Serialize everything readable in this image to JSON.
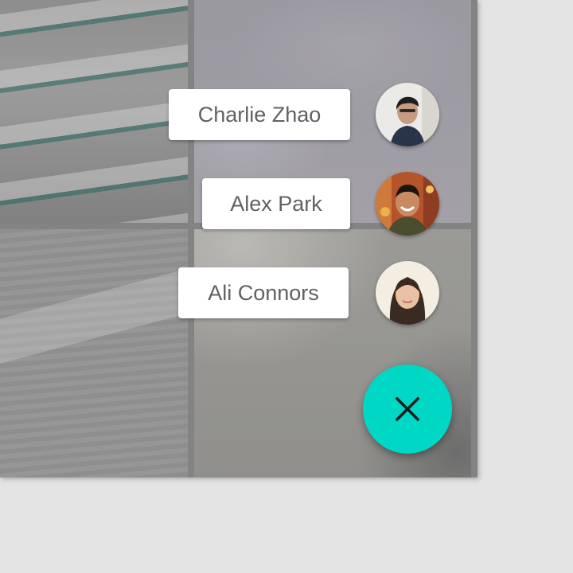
{
  "speed_dial": {
    "contacts": [
      {
        "name": "Charlie Zhao"
      },
      {
        "name": "Alex Park"
      },
      {
        "name": "Ali Connors"
      }
    ],
    "fab_icon": "close-icon",
    "fab_color": "#00d7c5"
  },
  "background_tiles": [
    "snow-landscape-photo",
    "misty-rocks-photo",
    "sand-dunes-photo",
    "stone-hill-photo"
  ]
}
